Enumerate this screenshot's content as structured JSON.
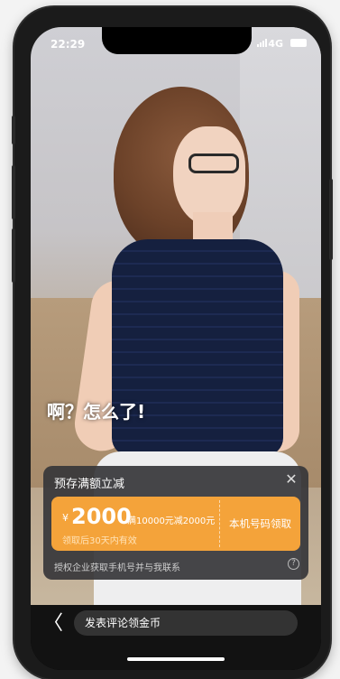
{
  "status_bar": {
    "time": "22:29",
    "network": "4G"
  },
  "video": {
    "caption": "啊？怎么了!"
  },
  "coupon_panel": {
    "title": "预存满额立减",
    "close_icon": "✕",
    "currency": "¥",
    "amount": "2000",
    "condition": "满10000元减2000元",
    "validity": "领取后30天内有效",
    "claim_button": "本机号码领取",
    "footer": "授权企业获取手机号并与我联系",
    "help_icon": "?"
  },
  "bottom_bar": {
    "back_icon": "〈",
    "comment_placeholder": "发表评论领金币"
  },
  "colors": {
    "accent": "#f4a33a",
    "panel_bg": "#36363a"
  }
}
